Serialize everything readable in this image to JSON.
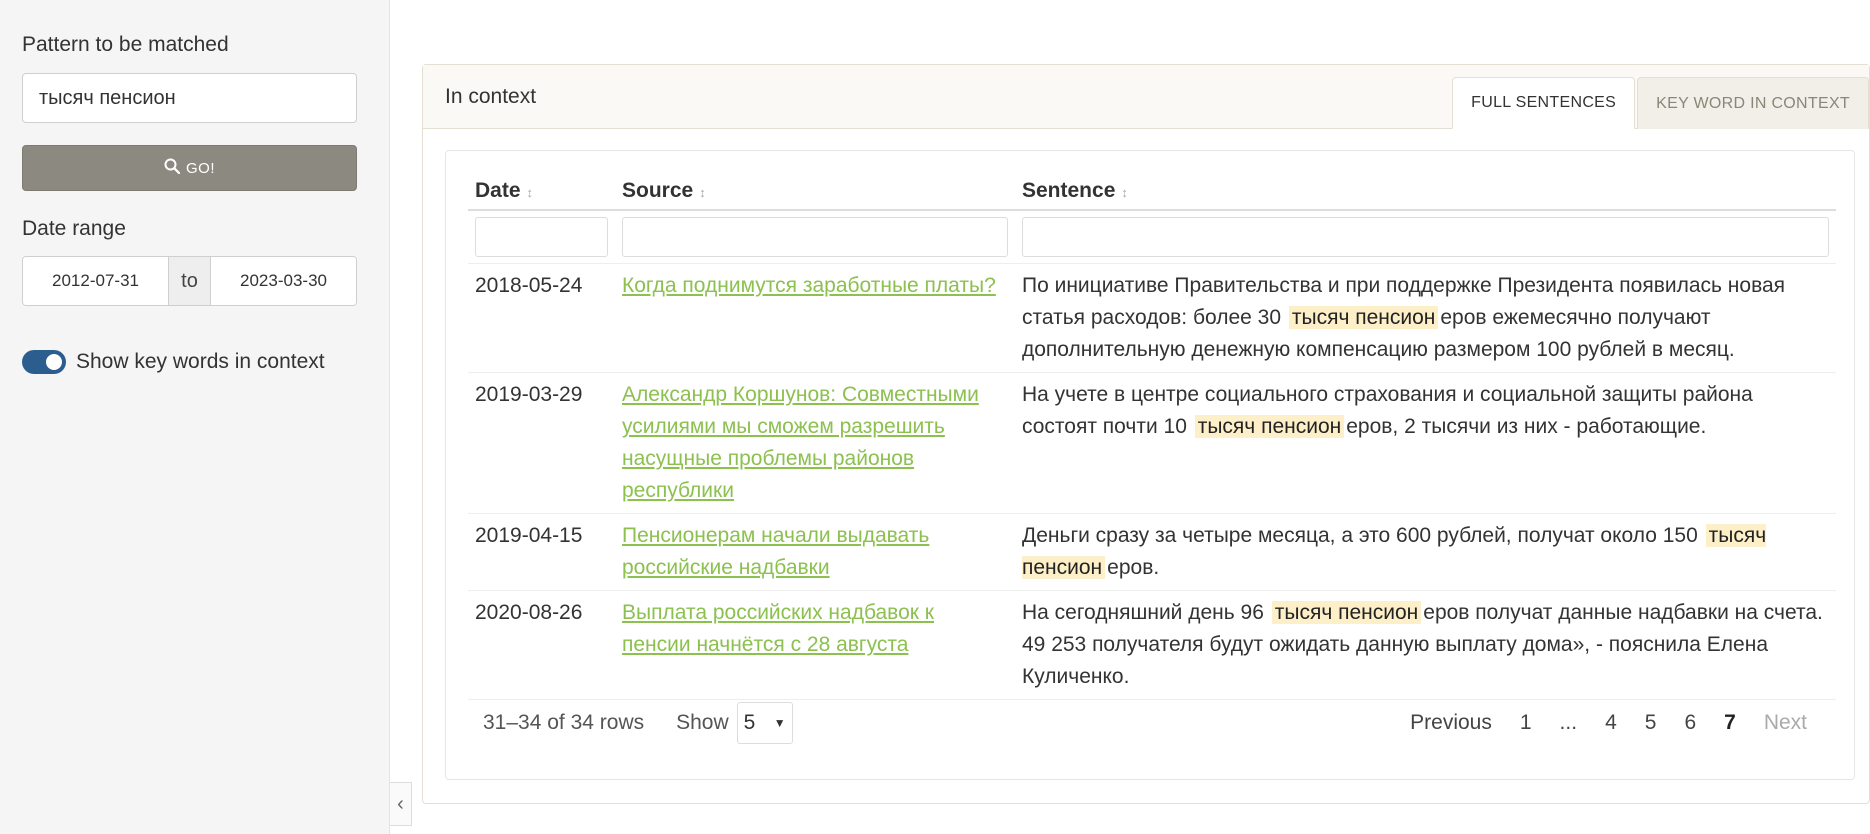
{
  "sidebar": {
    "pattern_label": "Pattern to be matched",
    "pattern_value": "тысяч пенсион",
    "go_label": "GO!",
    "date_range_label": "Date range",
    "date_from": "2012-07-31",
    "date_to_word": "to",
    "date_to": "2023-03-30",
    "toggle_label": "Show key words in context",
    "toggle_on": true
  },
  "card": {
    "title": "In context",
    "tabs": [
      {
        "label": "FULL SENTENCES",
        "active": true
      },
      {
        "label": "KEY WORD IN CONTEXT",
        "active": false
      }
    ]
  },
  "table": {
    "columns": [
      "Date",
      "Source",
      "Sentence"
    ],
    "rows": [
      {
        "date": "2018-05-24",
        "source": "Когда поднимутся заработные платы?",
        "pre": "По инициативе Правительства и при поддержке Президента появилась новая статья расходов: более 30",
        "key": "тысяч пенсион",
        "post": "еров ежемесячно получают дополнительную денежную компенсацию размером 100 рублей в месяц."
      },
      {
        "date": "2019-03-29",
        "source": "Александр Коршунов: Совместными усилиями мы сможем разрешить насущные проблемы районов республики",
        "pre": "На учете в центре социального страхования и социальной защиты района состоят почти 10",
        "key": "тысяч пенсион",
        "post": "еров, 2 тысячи из них - работающие."
      },
      {
        "date": "2019-04-15",
        "source": "Пенсионерам начали выдавать российские надбавки",
        "pre": "Деньги сразу за четыре месяца, а это 600 рублей, получат около 150",
        "key": "тысяч пенсион",
        "post": "еров."
      },
      {
        "date": "2020-08-26",
        "source": "Выплата российских надбавок к пенсии начнётся с 28 августа",
        "pre": "На сегодняшний день 96",
        "key": "тысяч пенсион",
        "post": "еров получат данные надбавки на счета. 49 253 получателя будут ожидать данную выплату дома», - пояснила Елена Куличенко."
      }
    ]
  },
  "footer": {
    "rows_info": "31–34 of 34 rows",
    "show_label": "Show",
    "page_size": "5",
    "previous": "Previous",
    "pages": [
      "1",
      "...",
      "4",
      "5",
      "6",
      "7"
    ],
    "current_page": "7",
    "next": "Next"
  }
}
